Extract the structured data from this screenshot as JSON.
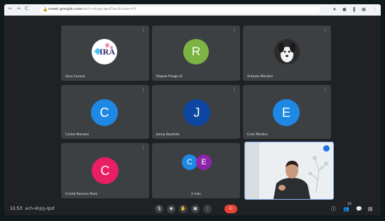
{
  "browser": {
    "nav_back": "←",
    "nav_forward": "→",
    "nav_reload": "C",
    "lock_icon": "lock-icon",
    "url_domain": "meet.google.com",
    "url_path": "/ach-ekpg-qpd?authuser=0",
    "right_icons": [
      "★",
      "●",
      "❚",
      "▣",
      "⋮"
    ]
  },
  "tiles": [
    {
      "name": "Sara Corona",
      "kind": "logo",
      "logo_text": "IRA"
    },
    {
      "name": "Raquel Priego Sr",
      "kind": "avatar",
      "initial": "R",
      "color": "#7cb342"
    },
    {
      "name": "Antonio Morales",
      "kind": "photo-dog"
    },
    {
      "name": "Carlos Morales",
      "kind": "avatar",
      "initial": "C",
      "color": "#1e88e5"
    },
    {
      "name": "Jeimy Bautista",
      "kind": "avatar",
      "initial": "J",
      "color": "#0d47a1"
    },
    {
      "name": "Erick Medina",
      "kind": "avatar",
      "initial": "E",
      "color": "#1e88e5"
    },
    {
      "name": "Cristal Romero Peck",
      "kind": "avatar",
      "initial": "C",
      "color": "#e91e63"
    },
    {
      "name": "2 más",
      "kind": "group",
      "initials": [
        "C",
        "E"
      ],
      "colors": [
        "#1e88e5",
        "#8e24aa"
      ]
    },
    {
      "name": "",
      "kind": "self-video"
    }
  ],
  "tile_menu": "⋮",
  "bottom_bar": {
    "time": "11:53",
    "meeting_code": "ach-ekpg-qpd",
    "controls": [
      "mic-icon",
      "camera-icon",
      "hand-icon",
      "present-icon",
      "more-icon",
      "end-call-icon"
    ],
    "control_glyphs": [
      "🎙",
      "◉",
      "✋",
      "▣",
      "⋮",
      "✆"
    ],
    "right_glyphs": [
      "ⓘ",
      "👥",
      "💬",
      "▤"
    ],
    "participant_count": "10"
  }
}
